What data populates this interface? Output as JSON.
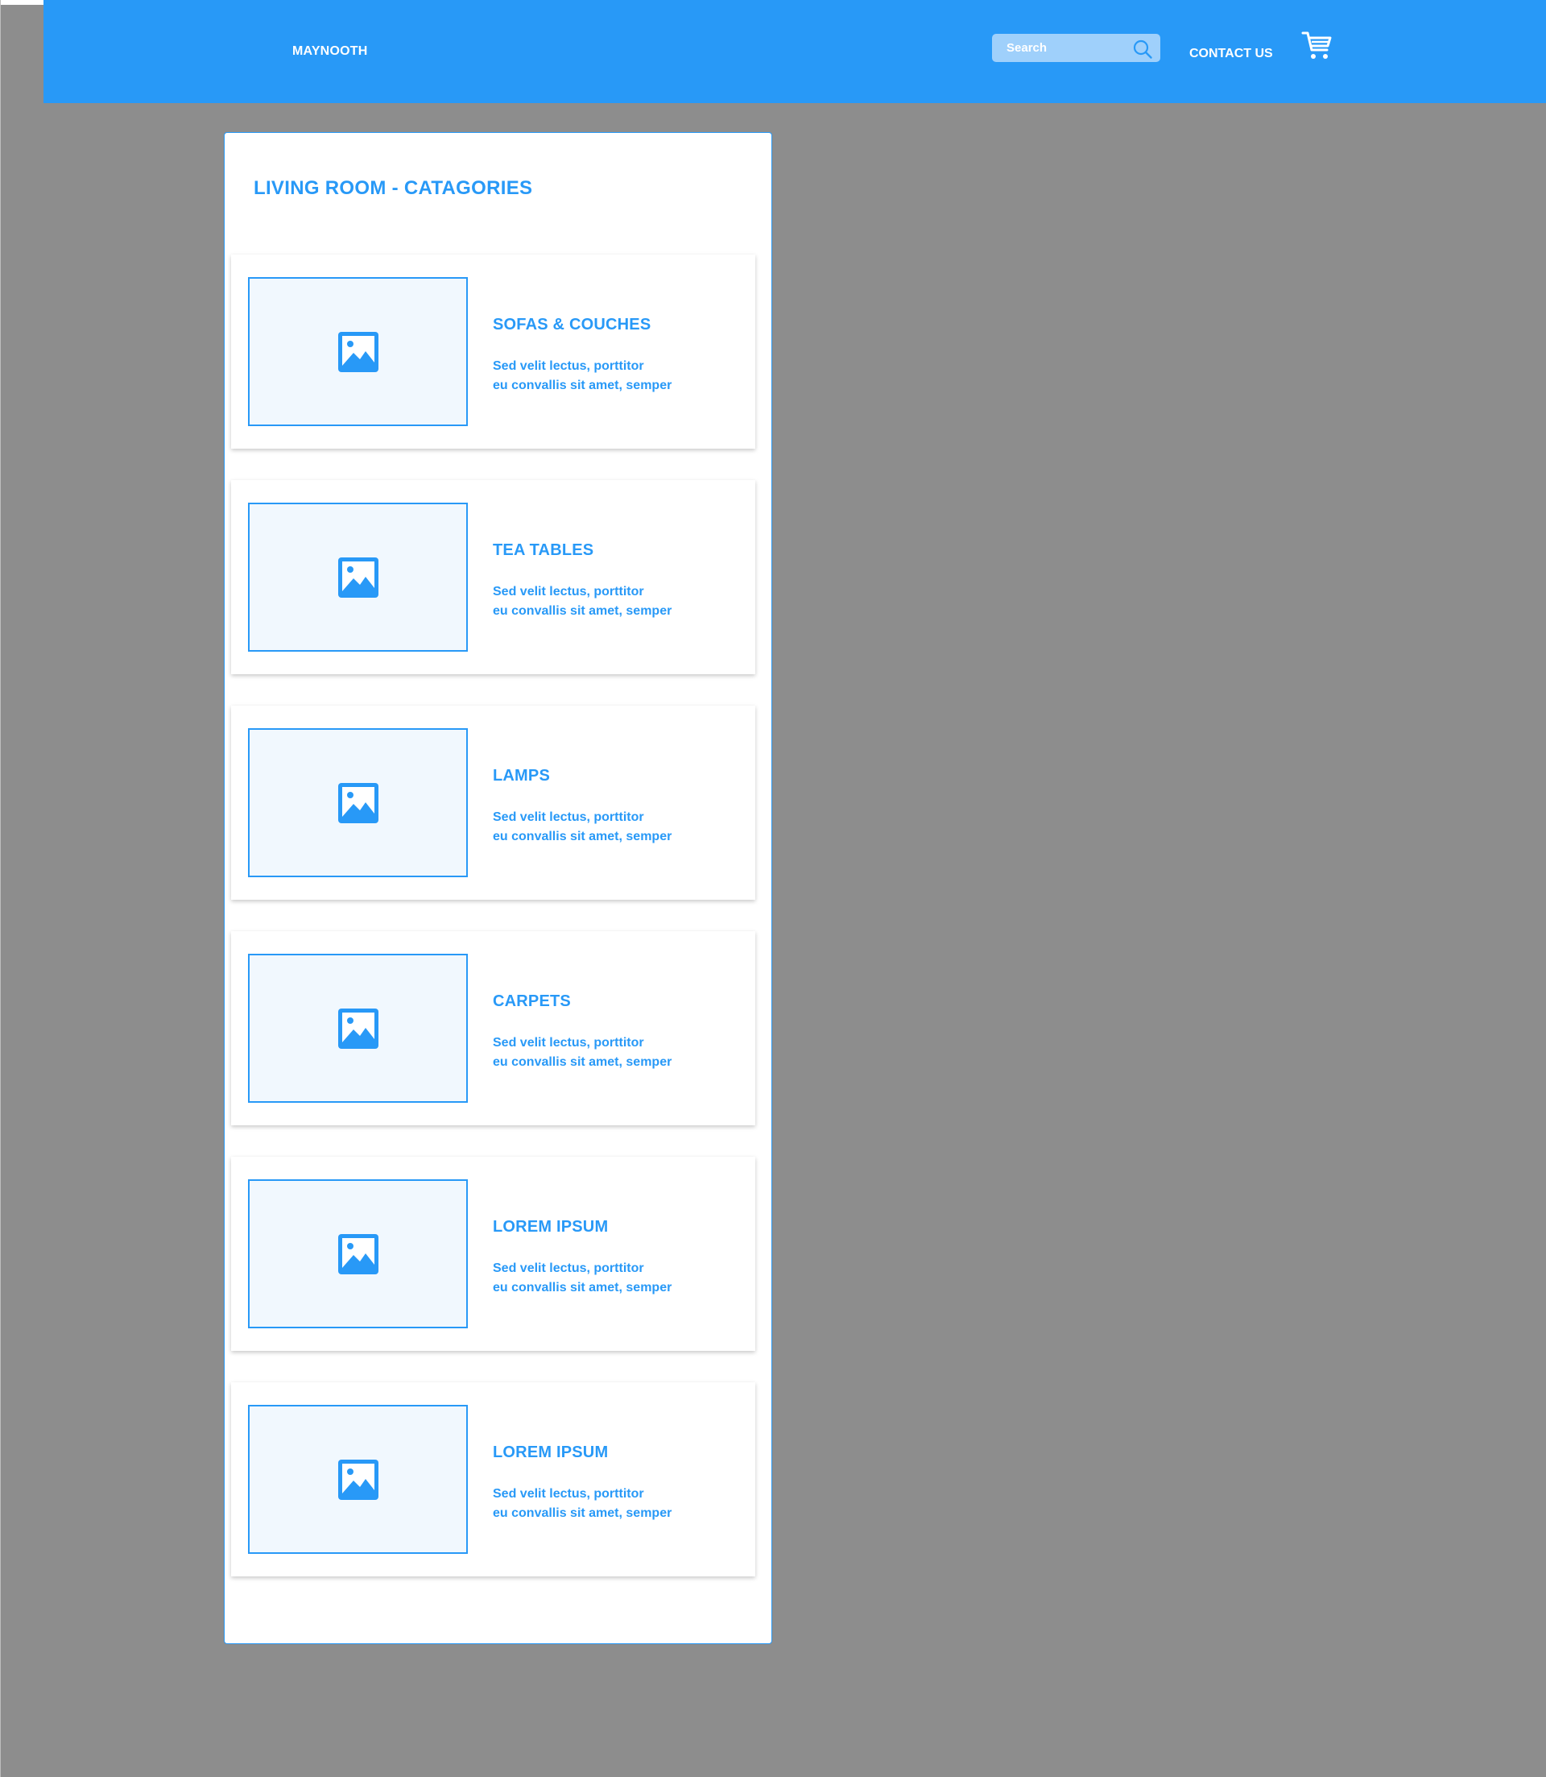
{
  "header": {
    "logo": "MAYNOOTH",
    "search_placeholder": "Search",
    "search_icon": "magnifier",
    "contact_label": "CONTACT US",
    "cart_icon": "shopping-cart"
  },
  "main": {
    "title": "LIVING ROOM - CATAGORIES",
    "categories": [
      {
        "title": "SOFAS & COUCHES",
        "line1": "Sed velit lectus, porttitor",
        "line2": "eu convallis sit amet, semper",
        "icon": "image-placeholder"
      },
      {
        "title": "TEA TABLES",
        "line1": "Sed velit lectus, porttitor",
        "line2": "eu convallis sit amet, semper",
        "icon": "image-placeholder"
      },
      {
        "title": "LAMPS",
        "line1": "Sed velit lectus, porttitor",
        "line2": "eu convallis sit amet, semper",
        "icon": "image-placeholder"
      },
      {
        "title": "CARPETS",
        "line1": "Sed velit lectus, porttitor",
        "line2": "eu convallis sit amet, semper",
        "icon": "image-placeholder"
      },
      {
        "title": "LOREM IPSUM",
        "line1": "Sed velit lectus, porttitor",
        "line2": "eu convallis sit amet, semper",
        "icon": "image-placeholder"
      },
      {
        "title": "LOREM IPSUM",
        "line1": "Sed velit lectus, porttitor",
        "line2": "eu convallis sit amet, semper",
        "icon": "image-placeholder"
      }
    ]
  },
  "colors": {
    "primary": "#2899f7",
    "background": "#8d8d8d",
    "search_bg": "#9fd0fb",
    "thumb_bg": "#f1f8fe",
    "panel": "#ffffff"
  }
}
